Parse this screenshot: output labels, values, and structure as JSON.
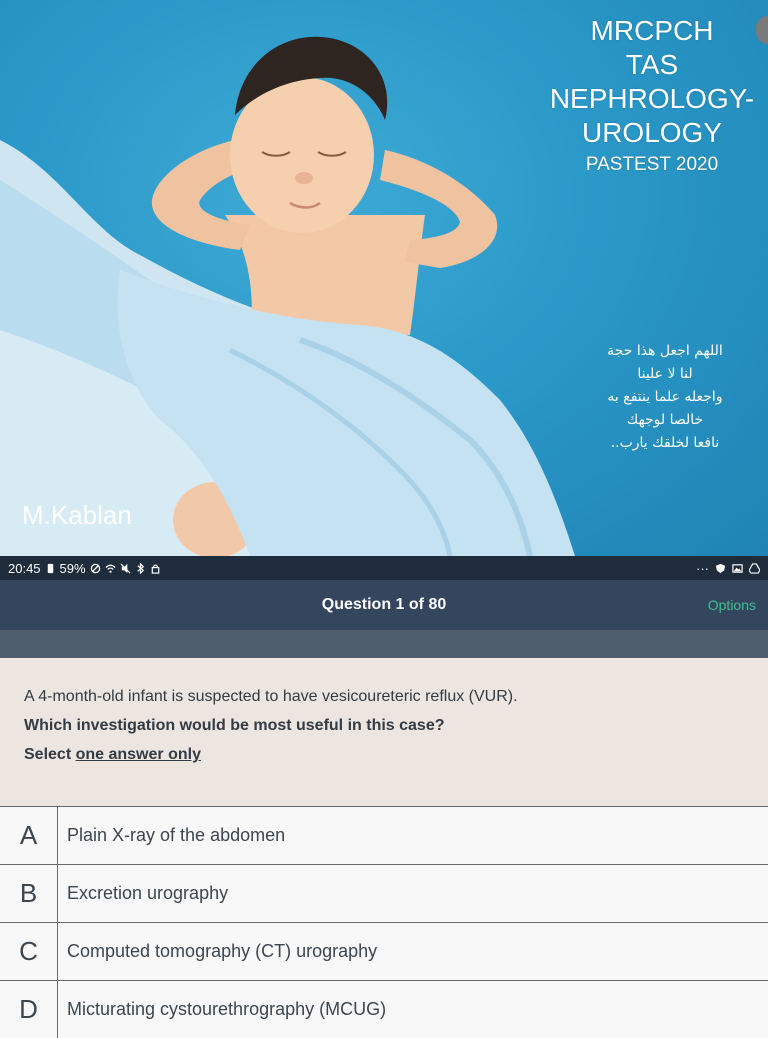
{
  "cover": {
    "title_lines": [
      "MRCPCH",
      "TAS",
      "NEPHROLOGY-",
      "UROLOGY"
    ],
    "subtitle": "PASTEST 2020",
    "dua_lines": [
      "اللهم اجعل هذا حجة",
      "لنا لا علينا",
      "واجعله علما ينتفع به",
      "خالصا لوجهك",
      "نافعا لخلقك يارب.."
    ],
    "author": "M.Kablan"
  },
  "status_bar": {
    "time": "20:45",
    "battery": "59%",
    "icons_left": [
      "battery-icon",
      "no-disturb-icon",
      "wifi-icon",
      "mute-icon",
      "bluetooth-icon",
      "lock-icon"
    ],
    "icons_right": [
      "more-dots-icon",
      "shield-icon",
      "gallery-icon",
      "drive-icon"
    ],
    "more": "···"
  },
  "header": {
    "title": "Question 1 of 80",
    "options_label": "Options"
  },
  "question": {
    "stem": "A 4-month-old infant is suspected to have vesicoureteric reflux (VUR).",
    "ask": "Which investigation would be most useful in this case?",
    "select_prefix": "Select ",
    "select_emphasis": "one answer only"
  },
  "answers": [
    {
      "letter": "A",
      "text": "Plain X-ray of the abdomen"
    },
    {
      "letter": "B",
      "text": "Excretion urography"
    },
    {
      "letter": "C",
      "text": "Computed tomography (CT) urography"
    },
    {
      "letter": "D",
      "text": "Micturating cystourethrography (MCUG)"
    }
  ],
  "colors": {
    "header_bg": "#33465e",
    "options": "#3fbf8f",
    "question_bg": "#ece5e0",
    "cover_blue": "#2a98c8"
  }
}
